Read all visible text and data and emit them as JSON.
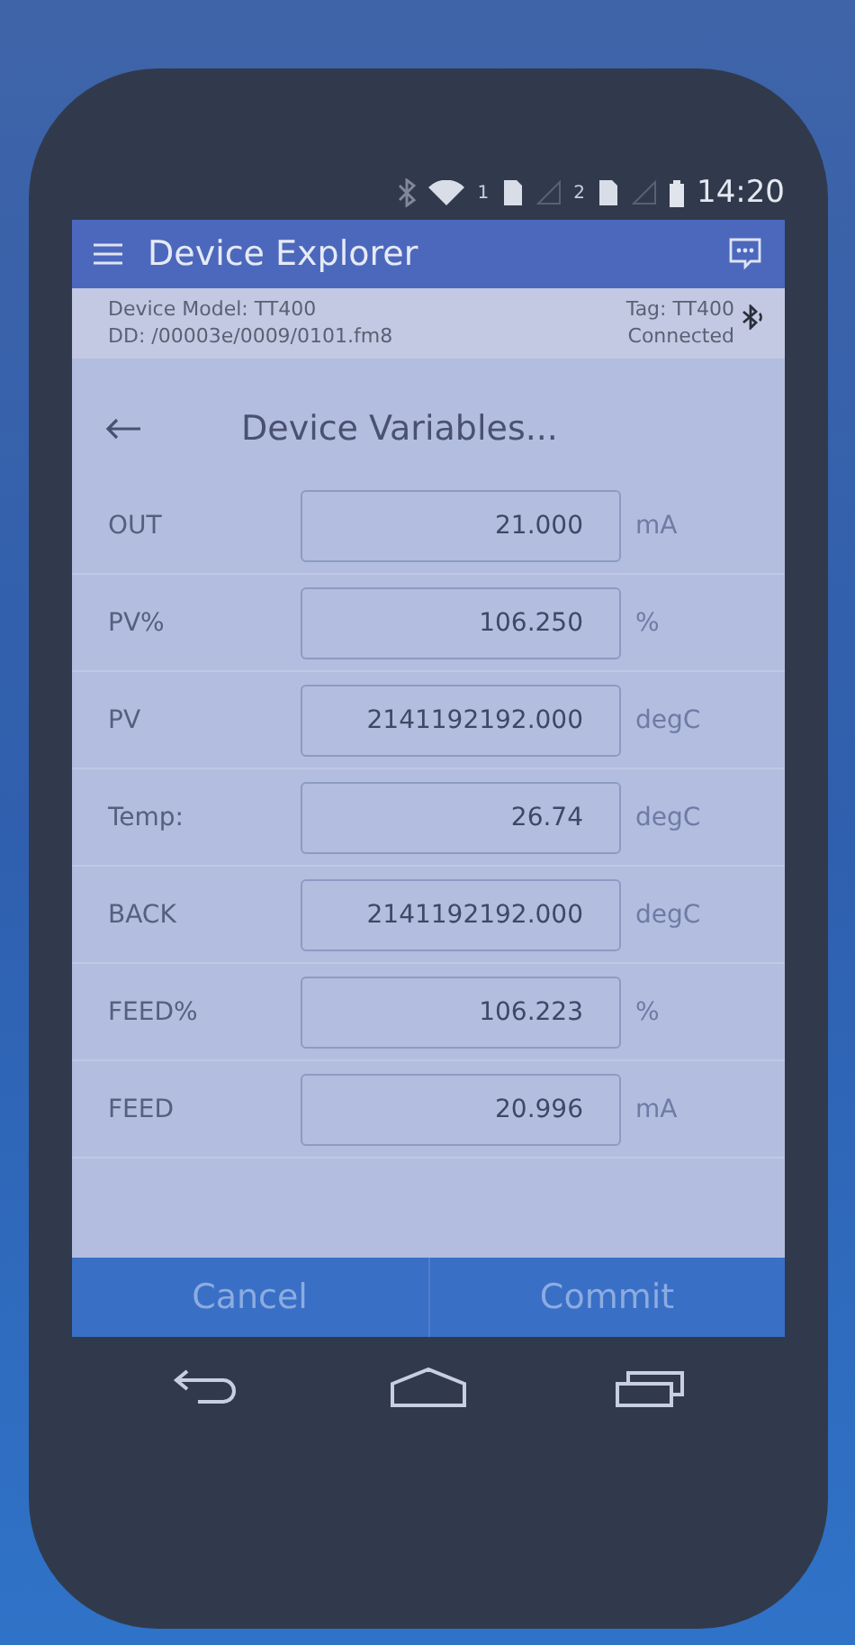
{
  "status_bar": {
    "sim_1": "1",
    "sim_2": "2",
    "time": "14:20"
  },
  "app_bar": {
    "title": "Device Explorer"
  },
  "device_info": {
    "model": "Device Model:  TT400",
    "dd": "DD:  /00003e/0009/0101.fm8",
    "tag": "Tag:  TT400",
    "connection": "Connected"
  },
  "page_title": "Device Variables...",
  "variables": [
    {
      "name": "OUT",
      "value": "21.000",
      "unit": "mA"
    },
    {
      "name": "PV%",
      "value": "106.250",
      "unit": "%"
    },
    {
      "name": "PV",
      "value": "2141192192.000",
      "unit": "degC"
    },
    {
      "name": "Temp:",
      "value": "26.74",
      "unit": "degC"
    },
    {
      "name": "BACK",
      "value": "2141192192.000",
      "unit": "degC"
    },
    {
      "name": "FEED%",
      "value": "106.223",
      "unit": "%"
    },
    {
      "name": "FEED",
      "value": "20.996",
      "unit": "mA"
    }
  ],
  "buttons": [
    "Cancel",
    "Commit"
  ]
}
